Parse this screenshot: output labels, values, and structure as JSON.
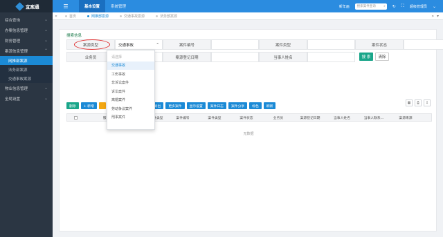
{
  "app": {
    "name": "宜案通"
  },
  "sidebar": {
    "items": [
      {
        "label": "综合查询"
      },
      {
        "label": "办案信息管理"
      },
      {
        "label": "财务管理"
      },
      {
        "label": "案源信息管理"
      }
    ],
    "subitems": [
      {
        "label": "网推部案源",
        "active": true
      },
      {
        "label": "法务部案源",
        "active": false
      },
      {
        "label": "交通事故案源",
        "active": false
      }
    ],
    "items_after": [
      {
        "label": "物业信息管理"
      },
      {
        "label": "全局设置"
      }
    ]
  },
  "header": {
    "menu_icon": "menu-icon",
    "tabs": [
      {
        "label": "基本设置",
        "active": true
      },
      {
        "label": "系统管理",
        "active": false
      }
    ],
    "link": "新年画",
    "search_placeholder": "搜索案件查询",
    "user": "超级管理员"
  },
  "page_tabs": [
    {
      "label": "首页",
      "active": false
    },
    {
      "label": "网推部案源",
      "active": true
    },
    {
      "label": "交通事故案源",
      "active": false
    },
    {
      "label": "法务部案源",
      "active": false
    }
  ],
  "search": {
    "title": "搜索信息",
    "row1": [
      {
        "label": "案源类型",
        "value": "交通事故"
      },
      {
        "label": "案件编号",
        "value": ""
      },
      {
        "label": "案件类型",
        "value": ""
      },
      {
        "label": "案件状态",
        "value": ""
      }
    ],
    "row2": [
      {
        "label": "业务员",
        "value": ""
      },
      {
        "label": "案源登记日期",
        "value": ""
      },
      {
        "label": "当事人姓名",
        "value": ""
      }
    ],
    "search_button": "搜 索",
    "clear_button": "清除"
  },
  "toolbar": {
    "buttons": [
      {
        "label": "删除",
        "style": "green"
      },
      {
        "label": "+ 新增",
        "style": "blue"
      },
      {
        "label": "",
        "style": "orange"
      },
      {
        "label": "",
        "style": "blue"
      },
      {
        "label": "导出",
        "style": "blue"
      },
      {
        "label": "更多案件",
        "style": "blue"
      },
      {
        "label": "显示设置",
        "style": "blue"
      },
      {
        "label": "案件日志",
        "style": "blue"
      },
      {
        "label": "案件分享",
        "style": "blue"
      },
      {
        "label": "标色",
        "style": "blue"
      },
      {
        "label": "刷新",
        "style": "blue"
      }
    ]
  },
  "table": {
    "columns": [
      "服务所",
      "",
      "案件类型",
      "案件编号",
      "案件类型",
      "案件状态",
      "业务员",
      "案源登记日期",
      "当事人姓名",
      "当事人联系...",
      "案源来源"
    ],
    "empty_text": "无数据"
  },
  "dropdown": {
    "options": [
      {
        "label": "请选择",
        "state": "placeholder"
      },
      {
        "label": "交通事故",
        "state": "selected"
      },
      {
        "label": "工伤事故",
        "state": ""
      },
      {
        "label": "非诉讼案件",
        "state": ""
      },
      {
        "label": "诉讼案件",
        "state": ""
      },
      {
        "label": "离婚案件",
        "state": ""
      },
      {
        "label": "劳动争议案件",
        "state": ""
      },
      {
        "label": "刑事案件",
        "state": ""
      }
    ]
  },
  "colors": {
    "header": "#2b8ce0",
    "sidebar": "#2b3643",
    "accent": "#1b8ad6",
    "green": "#1aa68a",
    "highlight": "#e03030"
  }
}
